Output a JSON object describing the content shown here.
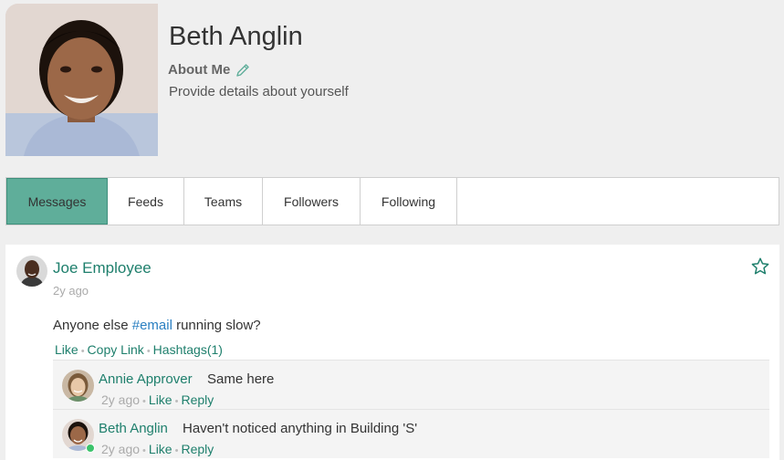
{
  "profile": {
    "name": "Beth Anglin",
    "about_label": "About Me",
    "about_text": "Provide details about yourself"
  },
  "tabs": [
    {
      "label": "Messages",
      "active": true
    },
    {
      "label": "Feeds",
      "active": false
    },
    {
      "label": "Teams",
      "active": false
    },
    {
      "label": "Followers",
      "active": false
    },
    {
      "label": "Following",
      "active": false
    }
  ],
  "post": {
    "author": "Joe Employee",
    "time": "2y ago",
    "text_before": "Anyone else ",
    "hashtag": "#email",
    "text_after": " running slow?",
    "actions": {
      "like": "Like",
      "copy_link": "Copy Link",
      "hashtags": "Hashtags(1)"
    },
    "favorite_icon": "star-outline-icon"
  },
  "comments": [
    {
      "author": "Annie Approver",
      "text": "Same here",
      "time": "2y ago",
      "like": "Like",
      "reply": "Reply"
    },
    {
      "author": "Beth Anglin",
      "text": "Haven't noticed anything in Building 'S'",
      "time": "2y ago",
      "like": "Like",
      "reply": "Reply",
      "online": true
    }
  ],
  "colors": {
    "accent": "#1e7f6c",
    "active_tab": "#5fae9a",
    "hashtag": "#2a7fc1",
    "presence": "#3cc36b"
  }
}
